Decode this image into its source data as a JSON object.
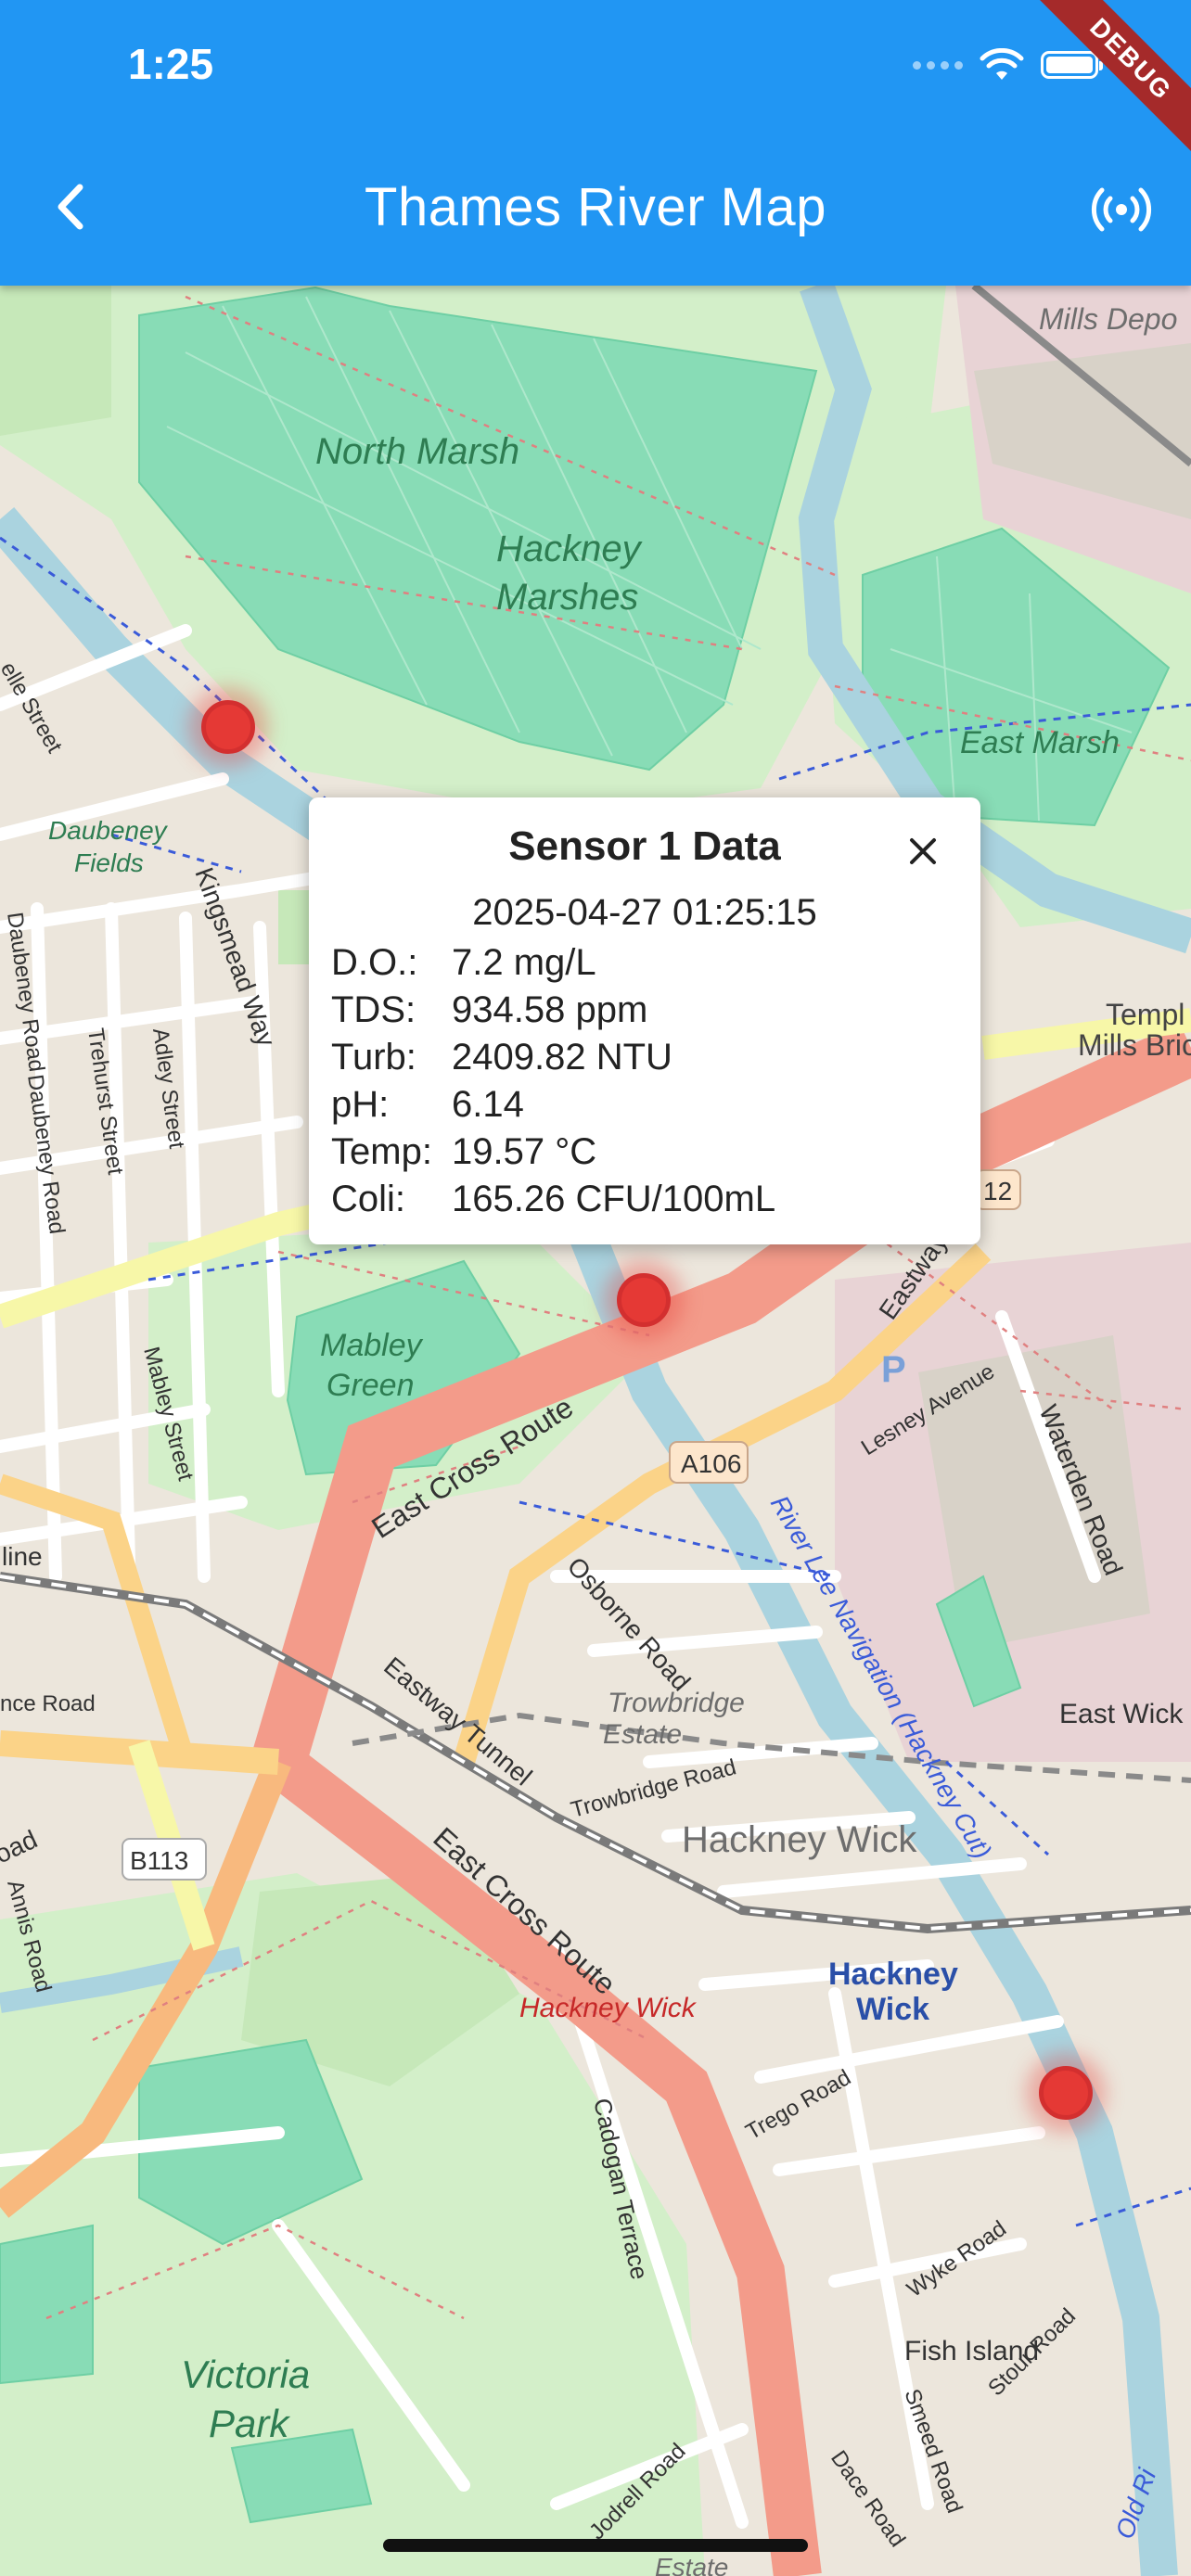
{
  "status_bar": {
    "time": "1:25"
  },
  "debug_banner": "DEBUG",
  "app_bar": {
    "title": "Thames River Map",
    "back_icon": "back-arrow-icon",
    "action_icon": "broadcast-signal-icon"
  },
  "map": {
    "labels": {
      "north_marsh": "North Marsh",
      "hackney_marshes_1": "Hackney",
      "hackney_marshes_2": "Marshes",
      "east_marsh": "East Marsh",
      "mills_depot": "Mills Depo",
      "temple_mills_1": "Templ",
      "temple_mills_2": "Mills Bric",
      "daubeney_fields_1": "Daubeney",
      "daubeney_fields_2": "Fields",
      "mabley_green_1": "Mabley",
      "mabley_green_2": "Green",
      "east_cross_route_1": "East Cross Route",
      "east_cross_route_2": "East Cross Route",
      "eastway": "Eastway",
      "eastway_tunnel": "Eastway Tunnel",
      "a106": "A106",
      "a12": "12",
      "b113": "B113",
      "osborne_road": "Osborne Road",
      "trowbridge_estate_1": "Trowbridge",
      "trowbridge_estate_2": "Estate",
      "trowbridge_road": "Trowbridge Road",
      "hackney_wick": "Hackney Wick",
      "hackney_wick_station_1": "Hackney",
      "hackney_wick_station_2": "Wick",
      "hackney_wick_red": "Hackney Wick",
      "east_wick": "East Wick",
      "river_lee": "River Lee Navigation (Hackney Cut)",
      "lesney_avenue": "Lesney Avenue",
      "waterden_road": "Waterden Road",
      "kingsmead_way": "Kingsmead Way",
      "daubeney_road_1": "Daubeney Road",
      "daubeney_road_2": "Daubeney Road",
      "trehurst_street": "Trehurst Street",
      "adley_street": "Adley Street",
      "mabley_street": "Mabley Street",
      "lille_street": "elle Street",
      "line": "line",
      "nce_road": "nce Road",
      "oad": "oad",
      "annis_road": "Annis Road",
      "cadogan_terrace": "Cadogan Terrace",
      "trego_road": "Trego Road",
      "wyke_road": "Wyke Road",
      "fish_island": "Fish Island",
      "stour_road": "Stour Road",
      "smeed_road": "Smeed Road",
      "dace_road": "Dace Road",
      "jodrell_road": "Jodrell Road",
      "victoria_park_1": "Victoria",
      "victoria_park_2": "Park",
      "old_river": "Old Ri",
      "estate_bottom": "Estate",
      "p": "P"
    }
  },
  "popup": {
    "title": "Sensor 1 Data",
    "timestamp": "2025-04-27 01:25:15",
    "rows": [
      {
        "label": "D.O.:",
        "value": "7.2 mg/L"
      },
      {
        "label": "TDS:",
        "value": "934.58 ppm"
      },
      {
        "label": "Turb:",
        "value": "2409.82 NTU"
      },
      {
        "label": "pH:",
        "value": "6.14"
      },
      {
        "label": "Temp:",
        "value": "19.57 °C"
      },
      {
        "label": "Coli:",
        "value": "165.26 CFU/100mL"
      }
    ]
  },
  "colors": {
    "app_bar": "#2196f3",
    "marker": "#e53935",
    "debug": "#a52a2a"
  }
}
